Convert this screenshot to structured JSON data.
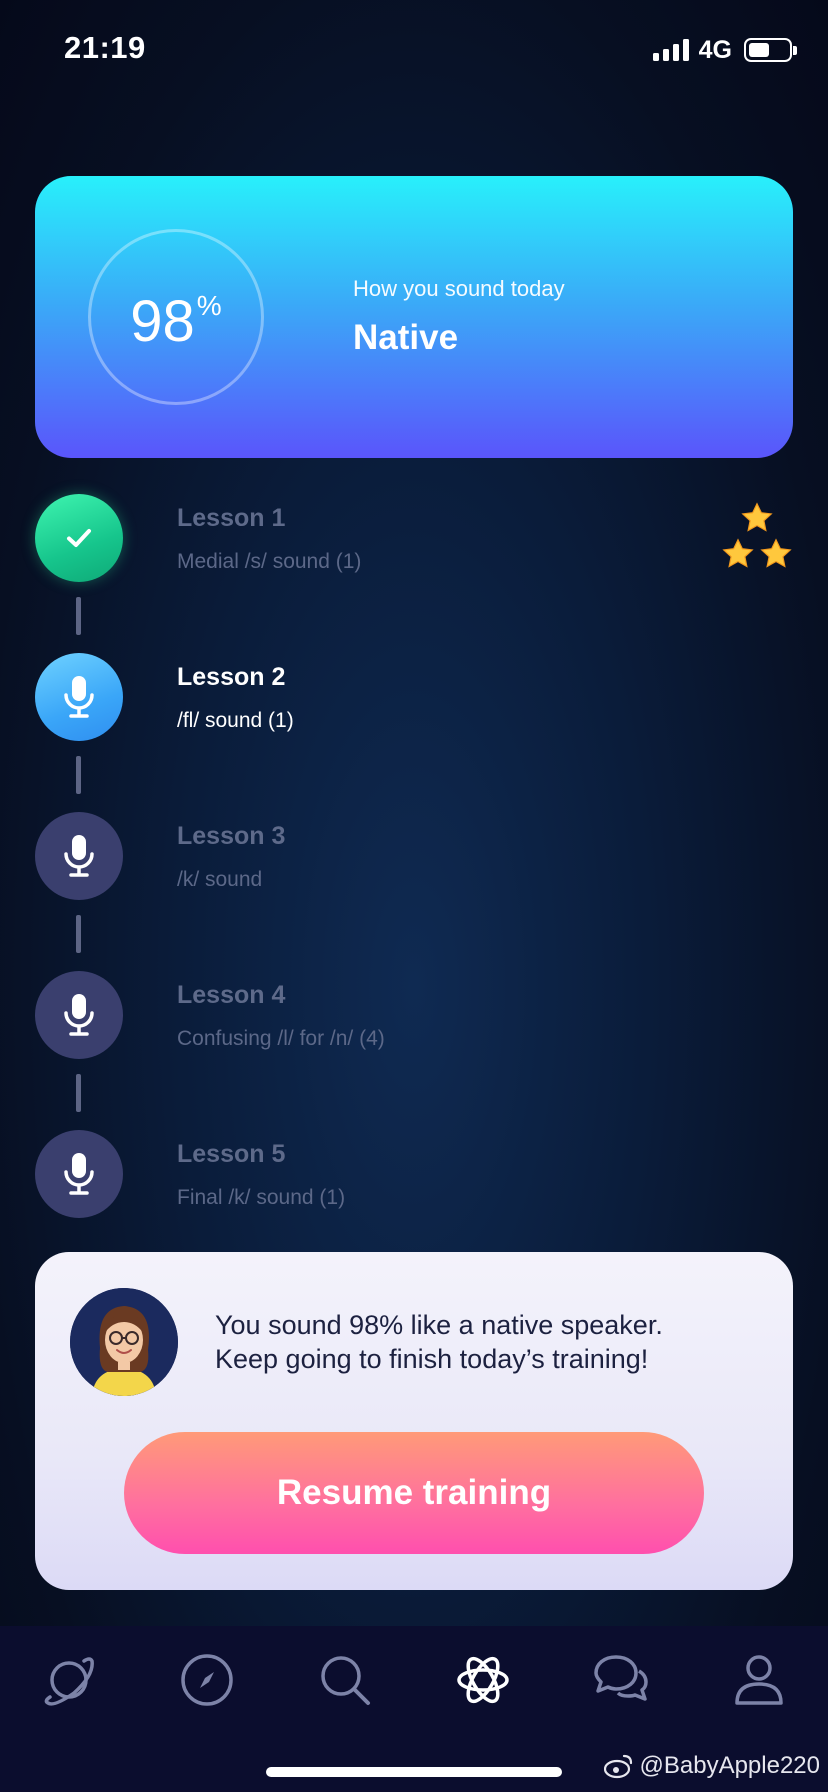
{
  "status_bar": {
    "time": "21:19",
    "network": "4G",
    "battery_level": 0.45
  },
  "score_card": {
    "score": "98",
    "score_unit": "%",
    "caption": "How you sound today",
    "level": "Native"
  },
  "lessons": [
    {
      "title": "Lesson 1",
      "subtitle": "Medial /s/ sound (1)",
      "state": "completed",
      "icon": "check-icon",
      "stars": 3
    },
    {
      "title": "Lesson 2",
      "subtitle": "/fl/ sound (1)",
      "state": "current",
      "icon": "microphone-icon"
    },
    {
      "title": "Lesson 3",
      "subtitle": "/k/ sound",
      "state": "locked",
      "icon": "microphone-icon"
    },
    {
      "title": "Lesson 4",
      "subtitle": "Confusing /l/ for /n/ (4)",
      "state": "locked",
      "icon": "microphone-icon"
    },
    {
      "title": "Lesson 5",
      "subtitle": "Final /k/ sound (1)",
      "state": "locked",
      "icon": "microphone-icon"
    }
  ],
  "coach_card": {
    "message_line1": "You sound 98% like a native speaker.",
    "message_line2": "Keep going to finish today’s training!",
    "resume_label": "Resume training"
  },
  "tab_bar": {
    "tabs": [
      {
        "icon": "planet-icon",
        "active": false
      },
      {
        "icon": "compass-icon",
        "active": false
      },
      {
        "icon": "search-icon",
        "active": false
      },
      {
        "icon": "atom-icon",
        "active": true
      },
      {
        "icon": "chat-icon",
        "active": false
      },
      {
        "icon": "profile-icon",
        "active": false
      }
    ]
  },
  "watermark": "@BabyApple220",
  "colors": {
    "accent_cyan": "#28f0fb",
    "accent_violet": "#5a55fb",
    "success_green": "#16c58c",
    "button_pink": "#ff4fae",
    "star_gold": "#ffc83d"
  }
}
